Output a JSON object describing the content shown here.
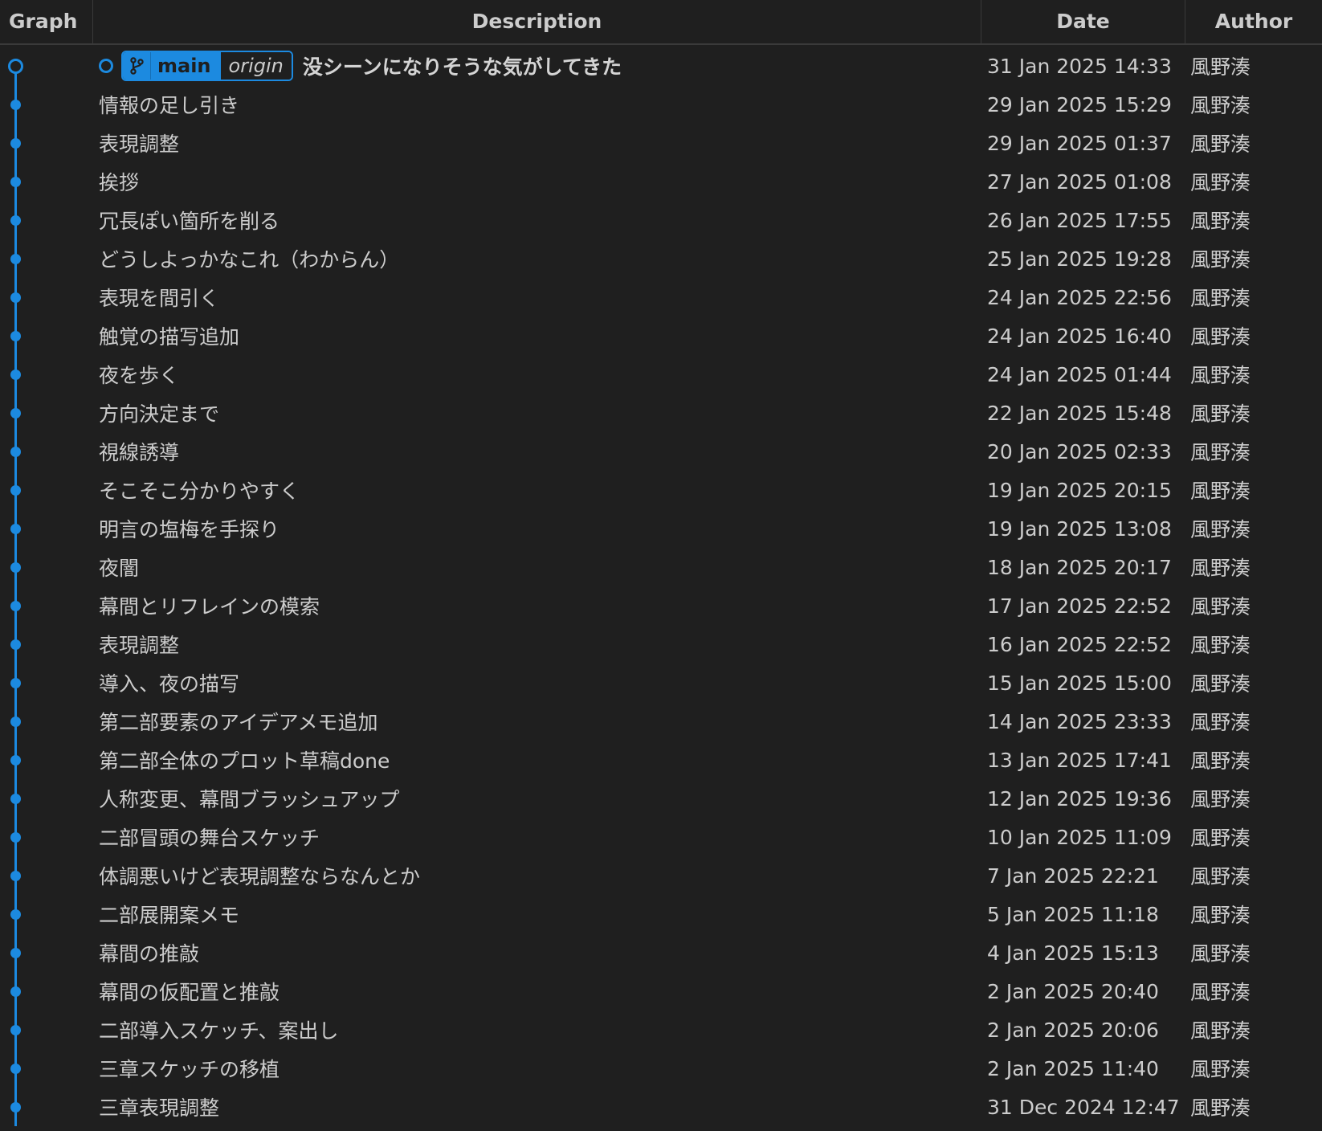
{
  "header": {
    "graph": "Graph",
    "description": "Description",
    "date": "Date",
    "author": "Author"
  },
  "head_ref": {
    "branch": "main",
    "remote": "origin",
    "icon": "git-branch-icon"
  },
  "colors": {
    "accent": "#1c8ae0",
    "background": "#1f1f1f",
    "text": "#cccccc"
  },
  "commits": [
    {
      "message": "没シーンになりそうな気がしてきた",
      "date": "31 Jan 2025 14:33",
      "author": "風野湊"
    },
    {
      "message": "情報の足し引き",
      "date": "29 Jan 2025 15:29",
      "author": "風野湊"
    },
    {
      "message": "表現調整",
      "date": "29 Jan 2025 01:37",
      "author": "風野湊"
    },
    {
      "message": "挨拶",
      "date": "27 Jan 2025 01:08",
      "author": "風野湊"
    },
    {
      "message": "冗長ぽい箇所を削る",
      "date": "26 Jan 2025 17:55",
      "author": "風野湊"
    },
    {
      "message": "どうしよっかなこれ（わからん）",
      "date": "25 Jan 2025 19:28",
      "author": "風野湊"
    },
    {
      "message": "表現を間引く",
      "date": "24 Jan 2025 22:56",
      "author": "風野湊"
    },
    {
      "message": "触覚の描写追加",
      "date": "24 Jan 2025 16:40",
      "author": "風野湊"
    },
    {
      "message": "夜を歩く",
      "date": "24 Jan 2025 01:44",
      "author": "風野湊"
    },
    {
      "message": "方向決定まで",
      "date": "22 Jan 2025 15:48",
      "author": "風野湊"
    },
    {
      "message": "視線誘導",
      "date": "20 Jan 2025 02:33",
      "author": "風野湊"
    },
    {
      "message": "そこそこ分かりやすく",
      "date": "19 Jan 2025 20:15",
      "author": "風野湊"
    },
    {
      "message": "明言の塩梅を手探り",
      "date": "19 Jan 2025 13:08",
      "author": "風野湊"
    },
    {
      "message": "夜闇",
      "date": "18 Jan 2025 20:17",
      "author": "風野湊"
    },
    {
      "message": "幕間とリフレインの模索",
      "date": "17 Jan 2025 22:52",
      "author": "風野湊"
    },
    {
      "message": "表現調整",
      "date": "16 Jan 2025 22:52",
      "author": "風野湊"
    },
    {
      "message": "導入、夜の描写",
      "date": "15 Jan 2025 15:00",
      "author": "風野湊"
    },
    {
      "message": "第二部要素のアイデアメモ追加",
      "date": "14 Jan 2025 23:33",
      "author": "風野湊"
    },
    {
      "message": "第二部全体のプロット草稿done",
      "date": "13 Jan 2025 17:41",
      "author": "風野湊"
    },
    {
      "message": "人称変更、幕間ブラッシュアップ",
      "date": "12 Jan 2025 19:36",
      "author": "風野湊"
    },
    {
      "message": "二部冒頭の舞台スケッチ",
      "date": "10 Jan 2025 11:09",
      "author": "風野湊"
    },
    {
      "message": "体調悪いけど表現調整ならなんとか",
      "date": "7 Jan 2025 22:21",
      "author": "風野湊"
    },
    {
      "message": "二部展開案メモ",
      "date": "5 Jan 2025 11:18",
      "author": "風野湊"
    },
    {
      "message": "幕間の推敲",
      "date": "4 Jan 2025 15:13",
      "author": "風野湊"
    },
    {
      "message": "幕間の仮配置と推敲",
      "date": "2 Jan 2025 20:40",
      "author": "風野湊"
    },
    {
      "message": "二部導入スケッチ、案出し",
      "date": "2 Jan 2025 20:06",
      "author": "風野湊"
    },
    {
      "message": "三章スケッチの移植",
      "date": "2 Jan 2025 11:40",
      "author": "風野湊"
    },
    {
      "message": "三章表現調整",
      "date": "31 Dec 2024 12:47",
      "author": "風野湊"
    }
  ]
}
